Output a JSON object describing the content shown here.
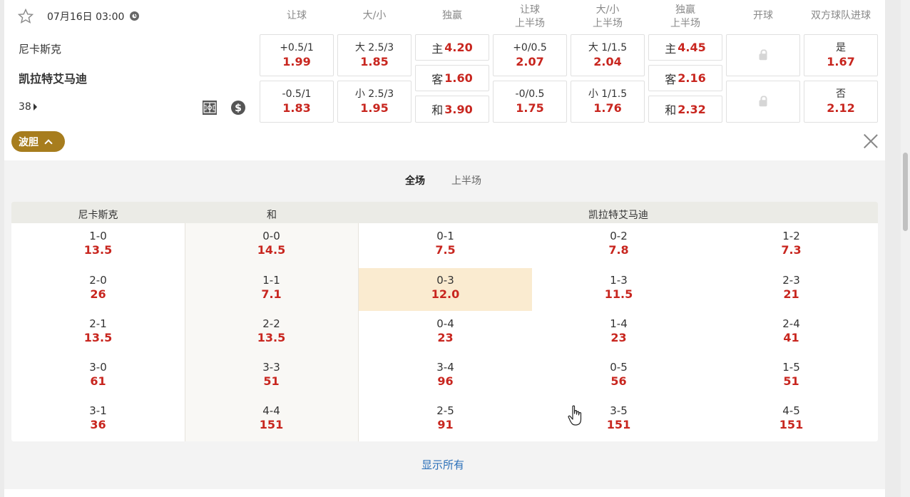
{
  "match": {
    "datetime": "07月16日 03:00",
    "home": "尼卡斯克",
    "away": "凯拉特艾马迪",
    "more_count": "38"
  },
  "headers": {
    "handicap": "让球",
    "ou": "大/小",
    "win": "独赢",
    "handicap_h1_a": "让球",
    "handicap_h1_b": "上半场",
    "ou_h1_a": "大/小",
    "ou_h1_b": "上半场",
    "win_h1_a": "独赢",
    "win_h1_b": "上半场",
    "kickoff": "开球",
    "btts": "双方球队进球"
  },
  "odds": {
    "hdp": [
      {
        "label": "+0.5/1",
        "value": "1.99"
      },
      {
        "label": "-0.5/1",
        "value": "1.83"
      }
    ],
    "ou": [
      {
        "label": "大 2.5/3",
        "value": "1.85"
      },
      {
        "label": "小 2.5/3",
        "value": "1.95"
      }
    ],
    "win": [
      {
        "label": "主",
        "value": "4.20"
      },
      {
        "label": "客",
        "value": "1.60"
      },
      {
        "label": "和",
        "value": "3.90"
      }
    ],
    "hdp_h1": [
      {
        "label": "+0/0.5",
        "value": "2.07"
      },
      {
        "label": "-0/0.5",
        "value": "1.75"
      }
    ],
    "ou_h1": [
      {
        "label": "大 1/1.5",
        "value": "2.04"
      },
      {
        "label": "小 1/1.5",
        "value": "1.76"
      }
    ],
    "win_h1": [
      {
        "label": "主",
        "value": "4.45"
      },
      {
        "label": "客",
        "value": "2.16"
      },
      {
        "label": "和",
        "value": "2.32"
      }
    ],
    "btts": [
      {
        "label": "是",
        "value": "1.67"
      },
      {
        "label": "否",
        "value": "2.12"
      }
    ]
  },
  "correct_score": {
    "pill_label": "波胆",
    "tabs": [
      "全场",
      "上半场"
    ],
    "col_headers": {
      "home": "尼卡斯克",
      "draw": "和",
      "away": "凯拉特艾马迪"
    },
    "columns": [
      [
        {
          "s": "1-0",
          "o": "13.5"
        },
        {
          "s": "2-0",
          "o": "26"
        },
        {
          "s": "2-1",
          "o": "13.5"
        },
        {
          "s": "3-0",
          "o": "61"
        },
        {
          "s": "3-1",
          "o": "36"
        }
      ],
      [
        {
          "s": "0-0",
          "o": "14.5"
        },
        {
          "s": "1-1",
          "o": "7.1"
        },
        {
          "s": "2-2",
          "o": "13.5"
        },
        {
          "s": "3-3",
          "o": "51"
        },
        {
          "s": "4-4",
          "o": "151"
        }
      ],
      [
        {
          "s": "0-1",
          "o": "7.5"
        },
        {
          "s": "0-3",
          "o": "12.0"
        },
        {
          "s": "0-4",
          "o": "23"
        },
        {
          "s": "3-4",
          "o": "96"
        },
        {
          "s": "2-5",
          "o": "91"
        }
      ],
      [
        {
          "s": "0-2",
          "o": "7.8"
        },
        {
          "s": "1-3",
          "o": "11.5"
        },
        {
          "s": "1-4",
          "o": "23"
        },
        {
          "s": "0-5",
          "o": "56"
        },
        {
          "s": "3-5",
          "o": "151"
        }
      ],
      [
        {
          "s": "1-2",
          "o": "7.3"
        },
        {
          "s": "2-3",
          "o": "21"
        },
        {
          "s": "2-4",
          "o": "41"
        },
        {
          "s": "1-5",
          "o": "51"
        },
        {
          "s": "4-5",
          "o": "151"
        }
      ]
    ],
    "show_all": "显示所有"
  },
  "colors": {
    "odds_red": "#c8261f",
    "accent_gold": "#a77d1e",
    "highlight": "#faebd0",
    "link_blue": "#2a6fb8"
  }
}
